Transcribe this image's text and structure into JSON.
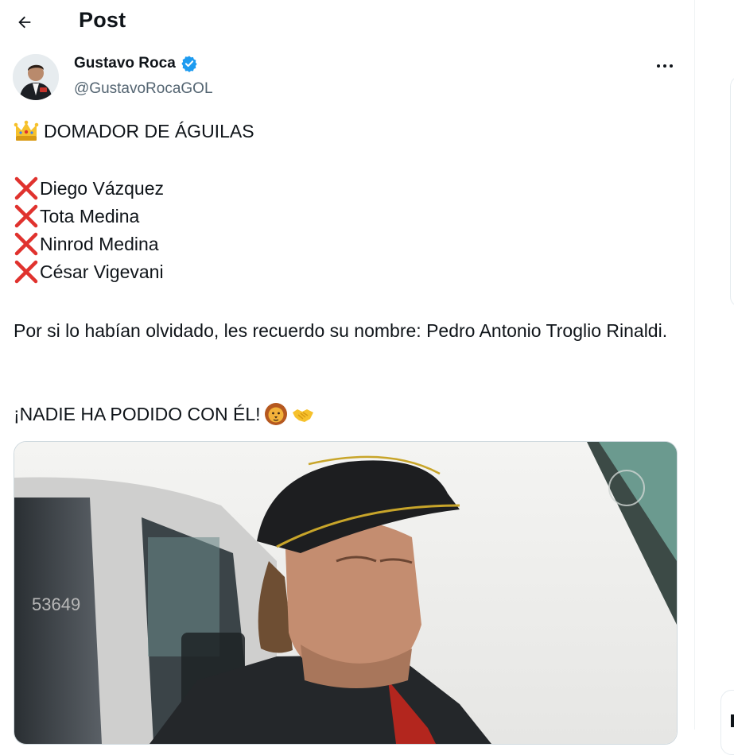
{
  "header": {
    "title": "Post"
  },
  "author": {
    "name": "Gustavo Roca",
    "handle": "@GustavoRocaGOL"
  },
  "post": {
    "headline": "DOMADOR DE ÁGUILAS",
    "crossed_names": [
      "Diego Vázquez",
      "Tota Medina",
      "Ninrod Medina",
      "César Vigevani"
    ],
    "paragraph": "Por si lo habían olvidado, les recuerdo su nombre: Pedro Antonio Troglio Rinaldi.",
    "closing": "¡NADIE HA PODIDO CON ÉL!"
  },
  "icons": {
    "back": "arrow-left-icon",
    "verified": "verified-badge-icon",
    "more": "more-horizontal-icon",
    "crown": "crown-emoji",
    "cross": "cross-mark-emoji",
    "lion": "lion-emoji",
    "handshake": "handshake-emoji"
  },
  "colors": {
    "verified": "#1d9bf0",
    "cross": "#e0322e",
    "handle": "#536471",
    "border": "#cfd9de"
  }
}
